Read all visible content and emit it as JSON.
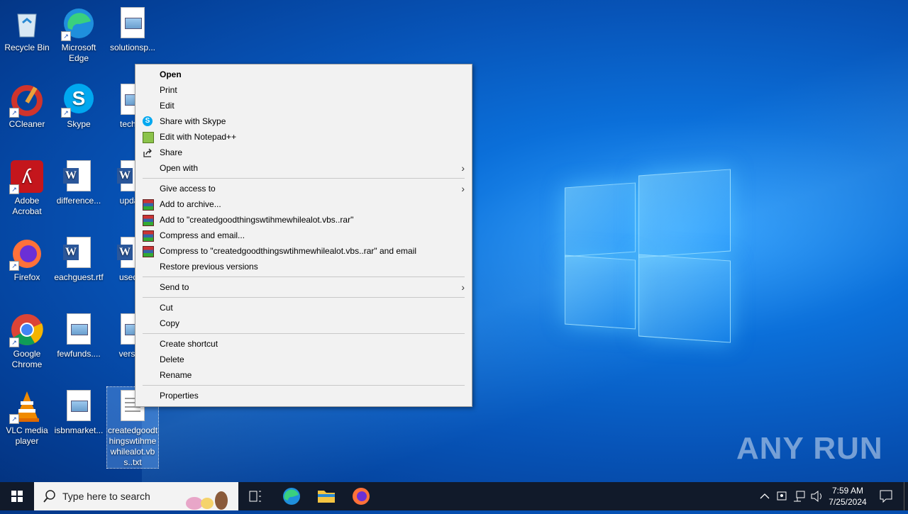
{
  "desktop": {
    "icons": [
      {
        "label": "Recycle Bin"
      },
      {
        "label": "Microsoft Edge"
      },
      {
        "label": "solutionsp..."
      },
      {
        "label": "CCleaner"
      },
      {
        "label": "Skype"
      },
      {
        "label": "techno"
      },
      {
        "label": "Adobe Acrobat"
      },
      {
        "label": "difference..."
      },
      {
        "label": "update"
      },
      {
        "label": "Firefox"
      },
      {
        "label": "eachguest.rtf"
      },
      {
        "label": "usedsc"
      },
      {
        "label": "Google Chrome"
      },
      {
        "label": "fewfunds...."
      },
      {
        "label": "version"
      },
      {
        "label": "VLC media player"
      },
      {
        "label": "isbnmarket..."
      },
      {
        "label": "createdgoodthingswtihmewhilealot.vbs..txt"
      }
    ]
  },
  "context_menu": {
    "items": [
      {
        "label": "Open"
      },
      {
        "label": "Print"
      },
      {
        "label": "Edit"
      },
      {
        "label": "Share with Skype"
      },
      {
        "label": "Edit with Notepad++"
      },
      {
        "label": "Share"
      },
      {
        "label": "Open with"
      },
      {
        "label": "Give access to"
      },
      {
        "label": "Add to archive..."
      },
      {
        "label": "Add to \"createdgoodthingswtihmewhilealot.vbs..rar\""
      },
      {
        "label": "Compress and email..."
      },
      {
        "label": "Compress to \"createdgoodthingswtihmewhilealot.vbs..rar\" and email"
      },
      {
        "label": "Restore previous versions"
      },
      {
        "label": "Send to"
      },
      {
        "label": "Cut"
      },
      {
        "label": "Copy"
      },
      {
        "label": "Create shortcut"
      },
      {
        "label": "Delete"
      },
      {
        "label": "Rename"
      },
      {
        "label": "Properties"
      }
    ],
    "submenu_arrow": "›"
  },
  "taskbar": {
    "search_placeholder": "Type here to search",
    "time": "7:59 AM",
    "date": "7/25/2024"
  },
  "watermark": "ANY RUN",
  "colors": {
    "accent": "#0b6fd9",
    "menu_bg": "#f2f2f2",
    "taskbar_bg": "#111a2a"
  }
}
